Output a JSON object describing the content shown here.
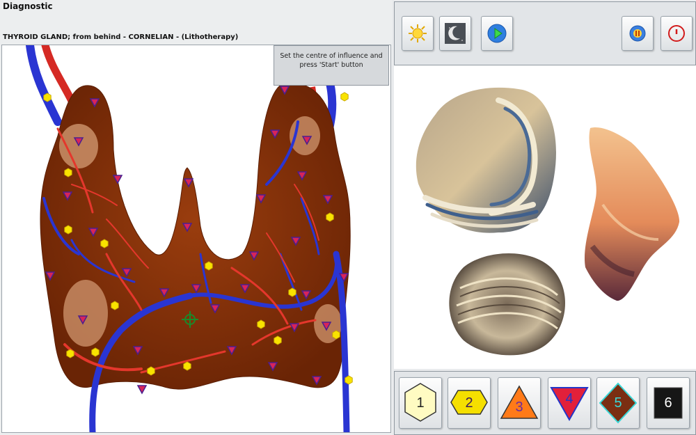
{
  "app": {
    "title": "Diagnostic",
    "subject": "THYROID GLAND; from behind - CORNELIAN - (Lithotherapy)"
  },
  "viewport": {
    "hint": "Set the centre of influence and press 'Start' button"
  },
  "toolbar": {
    "buttons": [
      {
        "name": "sun-icon"
      },
      {
        "name": "moon-icon"
      },
      {
        "name": "play-icon"
      },
      {
        "name": "pause-icon"
      },
      {
        "name": "power-icon"
      }
    ]
  },
  "levels": [
    {
      "label": "1",
      "shape": "hexagon",
      "fill": "#fffbc2",
      "text": "#222222"
    },
    {
      "label": "2",
      "shape": "hexagon",
      "fill": "#f5df00",
      "text": "#3a1a5a"
    },
    {
      "label": "3",
      "shape": "triangle-up",
      "fill": "#ff7a18",
      "text": "#6a2ba0"
    },
    {
      "label": "4",
      "shape": "triangle-down",
      "fill": "#e2203a",
      "text": "#2236c8"
    },
    {
      "label": "5",
      "shape": "diamond",
      "fill": "#7a2e12",
      "text": "#39d7d7"
    },
    {
      "label": "6",
      "shape": "square",
      "fill": "#161616",
      "text": "#ffffff"
    }
  ],
  "colors": {
    "gland": "#7d2d07",
    "vein": "#2530d6",
    "artery": "#e0322c",
    "marker_hex": "#f9e300",
    "marker_tri": "#7a2b9b"
  }
}
